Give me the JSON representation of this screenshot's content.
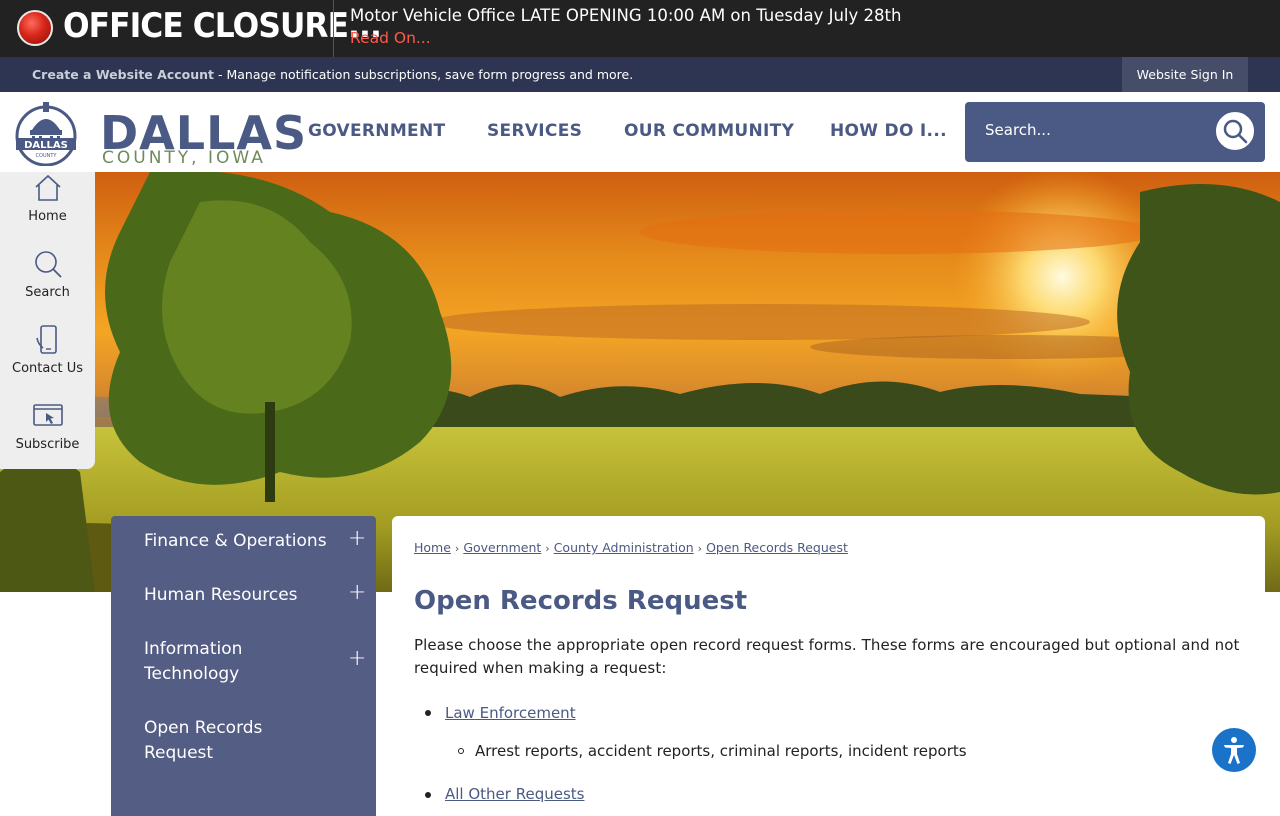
{
  "alert": {
    "title": "OFFICE CLOSURE...",
    "message": "Motor Vehicle Office LATE OPENING 10:00 AM on Tuesday July 28th",
    "read_on": "Read On..."
  },
  "account_bar": {
    "create_link": "Create a Website Account",
    "description": " - Manage notification subscriptions, save form progress and more.",
    "sign_in": "Website Sign In"
  },
  "header": {
    "logo_word": "DALLAS",
    "logo_sub": "COUNTY, IOWA",
    "nav": [
      "GOVERNMENT",
      "SERVICES",
      "OUR COMMUNITY",
      "HOW DO I..."
    ],
    "search_placeholder": "Search..."
  },
  "quick_links": [
    {
      "label": "Home",
      "icon": "home-icon"
    },
    {
      "label": "Search",
      "icon": "search-icon"
    },
    {
      "label": "Contact Us",
      "icon": "phone-icon"
    },
    {
      "label": "Subscribe",
      "icon": "subscribe-icon"
    }
  ],
  "side_nav": [
    {
      "label": "Finance & Operations",
      "expandable": true
    },
    {
      "label": "Human Resources",
      "expandable": true
    },
    {
      "label": "Information Technology",
      "expandable": true
    },
    {
      "label": "Open Records Request",
      "expandable": false
    }
  ],
  "breadcrumb": [
    "Home",
    "Government",
    "County Administration",
    "Open Records Request"
  ],
  "content": {
    "title": "Open Records Request",
    "intro": "Please choose the appropriate open record request forms. These forms are encouraged but optional and not required when making a request:",
    "items": [
      {
        "link": "Law Enforcement",
        "sub": "Arrest reports, accident reports, criminal reports, incident reports"
      },
      {
        "link": "All Other Requests"
      }
    ]
  },
  "colors": {
    "brand": "#4b5a84",
    "alert_red": "#ff5a4a",
    "sidenav_bg": "#545d83",
    "accessibility_blue": "#1a73c9"
  }
}
